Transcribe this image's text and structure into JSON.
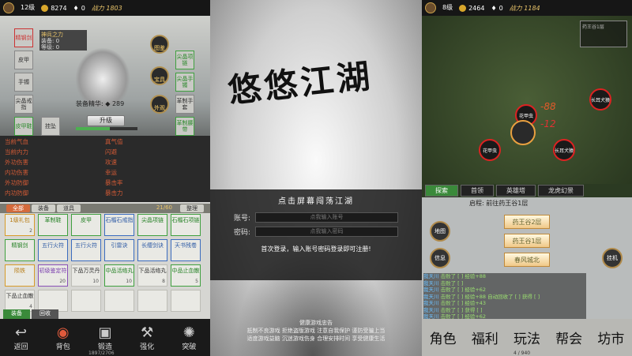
{
  "left": {
    "player": {
      "name": "",
      "level": "12级",
      "coin": "8274",
      "ingot": "0",
      "power": "战力 1803"
    },
    "hero": {
      "left_slots": [
        "精钢剑",
        "皮甲",
        "手镯",
        "尖晶戒指",
        "皮甲鞋",
        "挂坠"
      ],
      "skill_box": {
        "name": "神兵之力",
        "rows": [
          "装备: 0",
          "等级: 0"
        ]
      },
      "right_slots": [
        "尖晶项链",
        "尖晶手镯",
        "革制手套",
        "革制腰带"
      ],
      "round_btns": [
        "图鉴",
        "宝具",
        "外观"
      ],
      "essence_label": "装备精华:",
      "essence": "289",
      "upgrade": "升级",
      "exp_text": "1497/2706"
    },
    "stats": [
      [
        "当前气血",
        "",
        "真气值",
        ""
      ],
      [
        "当前内力",
        "",
        "闪避",
        ""
      ],
      [
        "外功伤害",
        "",
        "攻速",
        ""
      ],
      [
        "内功伤害",
        "",
        "幸运",
        ""
      ],
      [
        "外功防御",
        "",
        "暴击率",
        ""
      ],
      [
        "内功防御",
        "",
        "暴击力",
        ""
      ]
    ],
    "bag": {
      "tabs": [
        "全部",
        "装备",
        "道具"
      ],
      "count": "21/60",
      "sort": "整理",
      "items": [
        {
          "t": "1级礼包",
          "c": "o",
          "n": "2"
        },
        {
          "t": "革制鞋",
          "c": "g",
          "n": ""
        },
        {
          "t": "皮甲",
          "c": "g",
          "n": ""
        },
        {
          "t": "石榴石戒指",
          "c": "b",
          "n": ""
        },
        {
          "t": "尖晶项链",
          "c": "g",
          "n": ""
        },
        {
          "t": "石榴石项链",
          "c": "g",
          "n": ""
        },
        {
          "t": "精钢剑",
          "c": "g",
          "n": ""
        },
        {
          "t": "五行火符",
          "c": "b",
          "n": ""
        },
        {
          "t": "五行火符",
          "c": "b",
          "n": ""
        },
        {
          "t": "引雷诀",
          "c": "b",
          "n": ""
        },
        {
          "t": "长缨剑诀",
          "c": "b",
          "n": ""
        },
        {
          "t": "天书残卷",
          "c": "b",
          "n": ""
        },
        {
          "t": "陨铁",
          "c": "o",
          "n": ""
        },
        {
          "t": "初级鉴定符",
          "c": "p",
          "n": "20"
        },
        {
          "t": "下品万灵丹",
          "c": "",
          "n": "10"
        },
        {
          "t": "中品活络丸",
          "c": "g",
          "n": "10"
        },
        {
          "t": "下品活络丸",
          "c": "",
          "n": "8"
        },
        {
          "t": "中品止血散",
          "c": "g",
          "n": "5"
        },
        {
          "t": "下品止血散",
          "c": "",
          "n": "4"
        },
        {
          "t": "",
          "c": "e",
          "n": ""
        },
        {
          "t": "",
          "c": "e",
          "n": ""
        },
        {
          "t": "",
          "c": "e",
          "n": ""
        },
        {
          "t": "",
          "c": "e",
          "n": ""
        },
        {
          "t": "",
          "c": "e",
          "n": ""
        }
      ]
    },
    "bottom_tabs": [
      "装备",
      "回收"
    ],
    "nav": [
      {
        "label": "返回",
        "icon": "back-icon"
      },
      {
        "label": "背包",
        "icon": "bag-icon"
      },
      {
        "label": "锻造",
        "icon": "forge-icon"
      },
      {
        "label": "强化",
        "icon": "enhance-icon"
      },
      {
        "label": "突破",
        "icon": "break-icon"
      }
    ],
    "exp": "1897/2706"
  },
  "mid": {
    "title": "悠悠江湖",
    "login_header": "点击屏幕闯荡江湖",
    "account_label": "账号:",
    "account_placeholder": "点我输入账号",
    "password_label": "密码:",
    "password_placeholder": "点我输入密码",
    "note": "首次登录，输入账号密码登录即可注册!",
    "health_title": "健康游戏忠告",
    "health_lines": [
      "抵制不良游戏 拒绝盗版游戏 注意自我保护 谨防受骗上当",
      "适度游戏益脑 沉迷游戏伤身 合理安排时间 享受健康生活"
    ]
  },
  "right": {
    "player": {
      "name": "",
      "level": "8级",
      "coin": "2464",
      "ingot": "0",
      "power": "战力 1184"
    },
    "minimap": "药王谷1层",
    "monsters": [
      {
        "name": "长耳犬猿"
      },
      {
        "name": "花甲虫"
      },
      {
        "name": "花甲虫"
      },
      {
        "name": "长耳犬猿"
      }
    ],
    "damage": [
      "-88",
      "-12"
    ],
    "tabs": [
      "探索",
      "首领",
      "英雄塔",
      "龙虎幻景"
    ],
    "travel": "启程: 前往药王谷1层",
    "buttons": [
      "药王谷2层",
      "药王谷1层",
      "春风城北"
    ],
    "circles": [
      "地图",
      "信息",
      "挂机"
    ],
    "log": [
      {
        "n": "我天川",
        "t": "击败了 [ ] 经验+88"
      },
      {
        "n": "我天川",
        "t": "击败了 [ ]"
      },
      {
        "n": "我天川",
        "t": "击败了 [ ] 经验+62"
      },
      {
        "n": "我天川",
        "t": "击败了 [ ] 经验+88 自动回收了 [ ] 获得 [ ]"
      },
      {
        "n": "我天川",
        "t": "击败了 [ ] 经验+43"
      },
      {
        "n": "我天川",
        "t": "击败了 [ ] 获得 [ ]"
      },
      {
        "n": "我天川",
        "t": "击败了 [ ] 经验+62"
      }
    ],
    "nav": [
      "角色",
      "福利",
      "玩法",
      "帮会",
      "坊市"
    ],
    "exp": "4 / 940"
  }
}
